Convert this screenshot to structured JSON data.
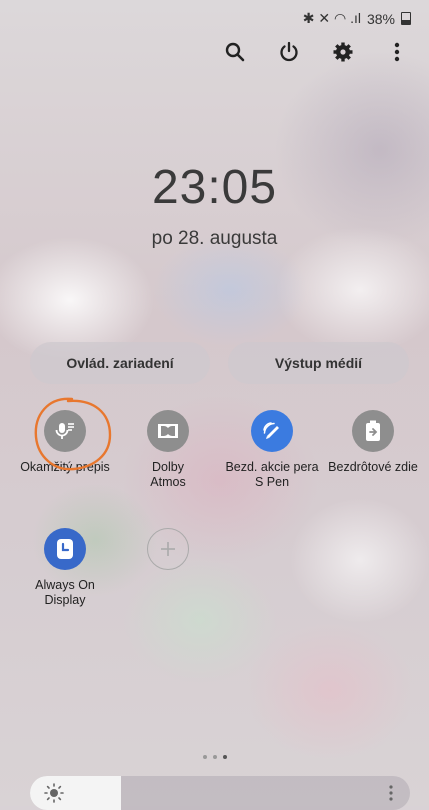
{
  "status_bar": {
    "icons_text": "✱ ✕ ◠ .ıl",
    "battery_text": "38%"
  },
  "top_icons": [
    "search-icon",
    "power-icon",
    "gear-icon",
    "more-vertical-icon"
  ],
  "clock": {
    "time": "23:05",
    "date": "po 28. augusta"
  },
  "pills": {
    "device_control": "Ovlád. zariadení",
    "media_output": "Výstup médií"
  },
  "tiles": [
    {
      "label": "Okamžitý prepis",
      "icon": "microphone-icon",
      "color": "#8e8e8e"
    },
    {
      "label": "Dolby\nAtmos",
      "icon": "dolby-icon",
      "color": "#8e8e8e"
    },
    {
      "label": "Bezd. akcie pera\nS Pen",
      "icon": "pen-icon",
      "color": "#3b7be0"
    },
    {
      "label": "Bezdrôtové zdie",
      "icon": "wireless-share-icon",
      "color": "#8e8e8e"
    },
    {
      "label": "Always On\nDisplay",
      "icon": "clock-icon",
      "color": "#3869c9"
    },
    {
      "label": "",
      "icon": "plus-icon",
      "color": "transparent"
    }
  ],
  "page_indicator": {
    "count": 3,
    "active": 2
  },
  "brightness": {
    "level": 0.24
  },
  "annotation": {
    "color": "#e8772e",
    "target": "Okamžitý prepis"
  }
}
